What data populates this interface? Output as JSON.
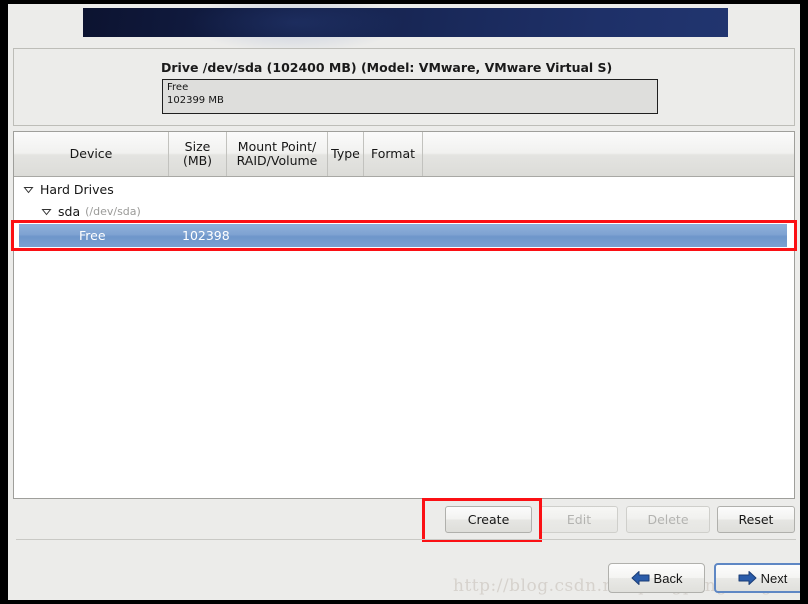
{
  "banner": {
    "name": "installer-banner"
  },
  "drive": {
    "title": "Drive /dev/sda (102400 MB) (Model: VMware, VMware Virtual S)",
    "segment_label": "Free",
    "segment_size": "102399 MB"
  },
  "table": {
    "columns": [
      {
        "label": "Device"
      },
      {
        "label": "Size\n(MB)",
        "line1": "Size",
        "line2": "(MB)"
      },
      {
        "label": "Mount Point/\nRAID/Volume",
        "line1": "Mount Point/",
        "line2": "RAID/Volume"
      },
      {
        "label": "Type"
      },
      {
        "label": "Format"
      }
    ],
    "rows": [
      {
        "label": "Hard Drives",
        "level": 0,
        "expanded": true,
        "icon": "chevron-down-icon"
      },
      {
        "label": "sda",
        "detail": "(/dev/sda)",
        "level": 1,
        "expanded": true,
        "icon": "chevron-down-icon"
      },
      {
        "label": "Free",
        "size": "102398",
        "level": 2,
        "selected": true
      }
    ]
  },
  "actions": {
    "create": "Create",
    "edit": "Edit",
    "delete": "Delete",
    "reset": "Reset"
  },
  "nav": {
    "back": "Back",
    "next": "Next"
  },
  "watermark": {
    "text": "http://blog.csdn.net/pengpengheng85"
  },
  "colors": {
    "banner_dark": "#0c1330",
    "banner_light": "#21356f",
    "selection_blue": "#7fa3d2",
    "highlight_red": "#fb1014",
    "focus_blue": "#5e87c4",
    "arrow_blue": "#2a5caa"
  }
}
